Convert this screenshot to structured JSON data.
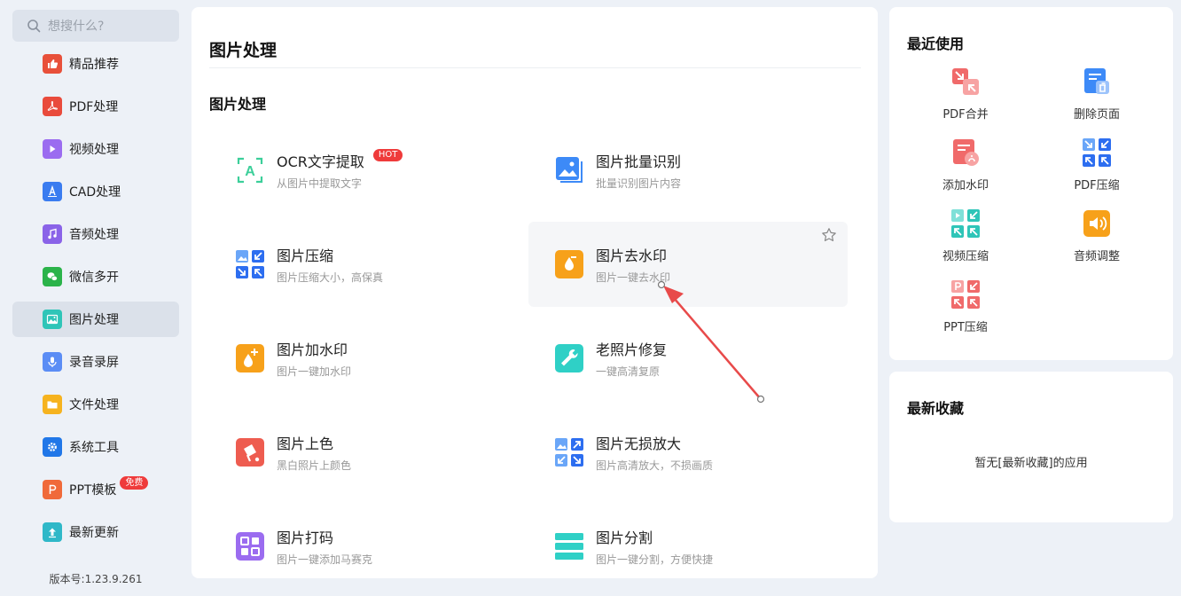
{
  "search": {
    "placeholder": "想搜什么?"
  },
  "sidebar": {
    "items": [
      {
        "label": "精品推荐",
        "icon": "thumbs-up-icon",
        "color": "#e8503a"
      },
      {
        "label": "PDF处理",
        "icon": "pdf-icon",
        "color": "#e94b3c"
      },
      {
        "label": "视频处理",
        "icon": "play-icon",
        "color": "#9b6cf0"
      },
      {
        "label": "CAD处理",
        "icon": "cad-icon",
        "color": "#3a7cf0"
      },
      {
        "label": "音频处理",
        "icon": "music-icon",
        "color": "#8a63e8"
      },
      {
        "label": "微信多开",
        "icon": "wechat-icon",
        "color": "#2bb34a"
      },
      {
        "label": "图片处理",
        "icon": "image-icon",
        "color": "#2fc5b8"
      },
      {
        "label": "录音录屏",
        "icon": "microphone-icon",
        "color": "#5b8df5"
      },
      {
        "label": "文件处理",
        "icon": "folder-icon",
        "color": "#f6b31f"
      },
      {
        "label": "系统工具",
        "icon": "gear-icon",
        "color": "#2177e8"
      },
      {
        "label": "PPT模板",
        "icon": "ppt-icon",
        "color": "#f06a3a",
        "badge": "免费"
      },
      {
        "label": "最新更新",
        "icon": "update-icon",
        "color": "#2fb8c8"
      }
    ],
    "version": "版本号:1.23.9.261"
  },
  "main": {
    "title": "图片处理",
    "section_title": "图片处理",
    "tools": [
      {
        "name": "OCR文字提取",
        "desc": "从图片中提取文字",
        "icon": "ocr-icon",
        "badge": "HOT"
      },
      {
        "name": "图片批量识别",
        "desc": "批量识别图片内容",
        "icon": "batch-image-icon"
      },
      {
        "name": "图片压缩",
        "desc": "图片压缩大小，高保真",
        "icon": "compress-icon"
      },
      {
        "name": "图片去水印",
        "desc": "图片一键去水印",
        "icon": "remove-watermark-icon"
      },
      {
        "name": "图片加水印",
        "desc": "图片一键加水印",
        "icon": "add-watermark-icon"
      },
      {
        "name": "老照片修复",
        "desc": "一键高清复原",
        "icon": "repair-icon"
      },
      {
        "name": "图片上色",
        "desc": "黑白照片上颜色",
        "icon": "colorize-icon"
      },
      {
        "name": "图片无损放大",
        "desc": "图片高清放大，不损画质",
        "icon": "enlarge-icon"
      },
      {
        "name": "图片打码",
        "desc": "图片一键添加马赛克",
        "icon": "mosaic-icon"
      },
      {
        "name": "图片分割",
        "desc": "图片一键分割，方便快捷",
        "icon": "split-icon"
      }
    ]
  },
  "recent": {
    "title": "最近使用",
    "items": [
      {
        "label": "PDF合并",
        "icon": "pdf-merge-icon"
      },
      {
        "label": "删除页面",
        "icon": "delete-page-icon"
      },
      {
        "label": "添加水印",
        "icon": "add-watermark-icon"
      },
      {
        "label": "PDF压缩",
        "icon": "pdf-compress-icon"
      },
      {
        "label": "视频压缩",
        "icon": "video-compress-icon"
      },
      {
        "label": "音频调整",
        "icon": "audio-adjust-icon"
      },
      {
        "label": "PPT压缩",
        "icon": "ppt-compress-icon"
      }
    ]
  },
  "favorites": {
    "title": "最新收藏",
    "empty_text": "暂无[最新收藏]的应用"
  }
}
